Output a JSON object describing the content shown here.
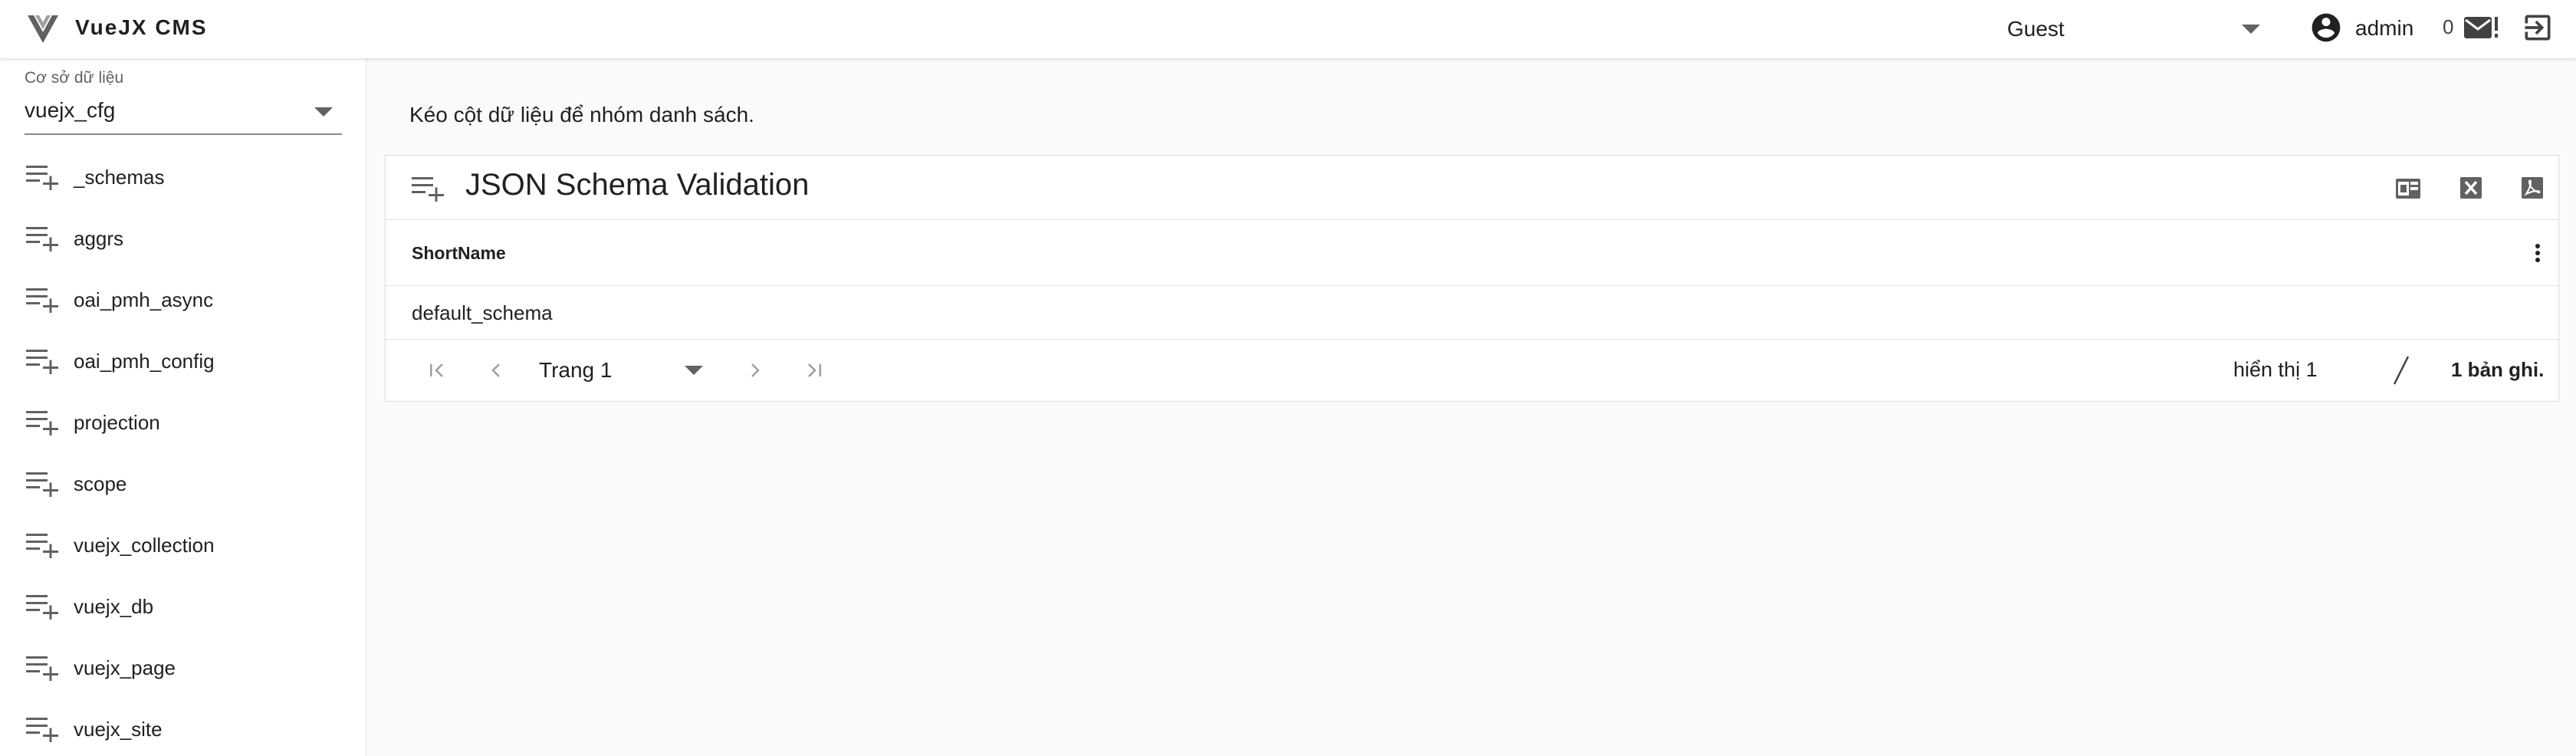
{
  "app": {
    "title": "VueJX CMS"
  },
  "header": {
    "role": "Guest",
    "user": "admin",
    "mail_count": "0"
  },
  "sidebar": {
    "db_label": "Cơ sở dữ liệu",
    "db_value": "vuejx_cfg",
    "items": [
      {
        "label": "_schemas"
      },
      {
        "label": "aggrs"
      },
      {
        "label": "oai_pmh_async"
      },
      {
        "label": "oai_pmh_config"
      },
      {
        "label": "projection"
      },
      {
        "label": "scope"
      },
      {
        "label": "vuejx_collection"
      },
      {
        "label": "vuejx_db"
      },
      {
        "label": "vuejx_page"
      },
      {
        "label": "vuejx_site"
      }
    ]
  },
  "main": {
    "group_hint": "Kéo cột dữ liệu để nhóm danh sách.",
    "panel_title": "JSON Schema Validation",
    "columns": [
      "ShortName"
    ],
    "rows": [
      [
        "default_schema"
      ]
    ],
    "pager": {
      "page": "Trang 1",
      "display": "hiển thị 1",
      "total": "1 bản ghi."
    }
  },
  "icons": {
    "logo": "vuejx-logo-icon",
    "user": "account-circle-icon",
    "mail": "mail-alert-icon",
    "logout": "logout-icon",
    "list": "playlist-add-icon",
    "export_card": "card-export-icon",
    "export_excel": "excel-icon",
    "export_pdf": "pdf-icon"
  },
  "colors": {
    "icon": "#616161",
    "background": "#fafafa",
    "surface": "#ffffff"
  }
}
